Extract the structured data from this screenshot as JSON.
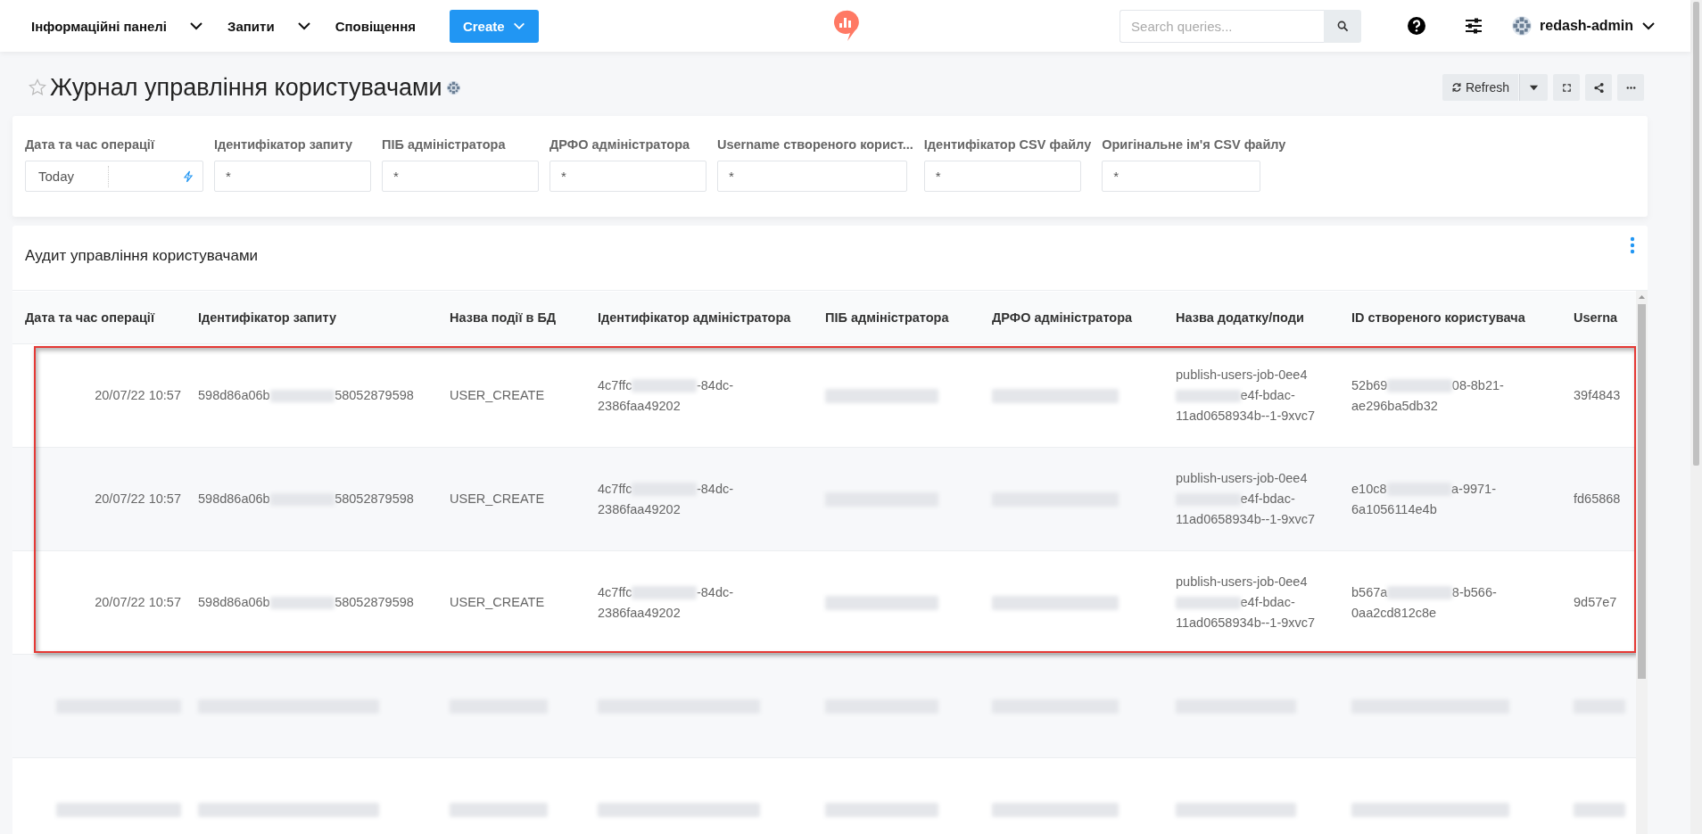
{
  "navbar": {
    "menu": [
      {
        "label": "Інформаційні панелі",
        "dropdown": true
      },
      {
        "label": "Запити",
        "dropdown": true
      },
      {
        "label": "Сповіщення",
        "dropdown": false
      }
    ],
    "create_button": "Create",
    "search": {
      "placeholder": "Search queries..."
    },
    "user": "redash-admin"
  },
  "dashboard": {
    "title": "Журнал управління користувачами",
    "favorite": false,
    "buttons": [
      {
        "kind": "refresh",
        "label": "Refresh"
      },
      {
        "kind": "caret"
      },
      {
        "kind": "fullscreen"
      },
      {
        "kind": "share"
      },
      {
        "kind": "more"
      }
    ]
  },
  "filters": [
    {
      "kind": "date",
      "label": "Дата та час операції",
      "value": "Today"
    },
    {
      "kind": "text",
      "label": "Ідентифікатор запиту",
      "value": "*"
    },
    {
      "kind": "text",
      "label": "ПІБ адміністратора",
      "value": "*"
    },
    {
      "kind": "text",
      "label": "ДРФО адміністратора",
      "value": "*"
    },
    {
      "kind": "text",
      "label": "Username створеного корист...",
      "value": "*"
    },
    {
      "kind": "text",
      "label": "Ідентифікатор CSV файлу",
      "value": "*"
    },
    {
      "kind": "text",
      "label": "Оригінальне ім'я CSV файлу",
      "value": "*"
    }
  ],
  "widget": {
    "title": "Аудит управління користувачами",
    "columns": [
      "Дата та час операції",
      "Ідентифікатор запиту",
      "Назва події в БД",
      "Ідентифікатор адміністратора",
      "ПІБ адміністратора",
      "ДРФО адміністратора",
      "Назва додатку/поди",
      "ID створеного користувача",
      "Userna"
    ],
    "rows": [
      {
        "highlighted": true,
        "cells": [
          [
            {
              "text": "20/07/22 10:57"
            }
          ],
          [
            {
              "text": "598d86a06b"
            },
            {
              "kind": "redacted"
            },
            {
              "text": "58052879598"
            }
          ],
          [
            {
              "text": "USER_CREATE"
            }
          ],
          [
            {
              "text": "4c7ffc"
            },
            {
              "kind": "redacted"
            },
            {
              "text": "-84dc-2386faa49202"
            }
          ],
          [
            {
              "kind": "redacted"
            }
          ],
          [
            {
              "kind": "redacted"
            }
          ],
          [
            {
              "text": "publish-users-job-0ee4"
            },
            {
              "kind": "redacted"
            },
            {
              "text": "e4f-bdac-11ad0658934b--1-9xvc7"
            }
          ],
          [
            {
              "text": "52b69"
            },
            {
              "kind": "redacted"
            },
            {
              "text": "08-8b21-ae296ba5db32"
            }
          ],
          [
            {
              "text": "39f4843"
            }
          ]
        ]
      },
      {
        "highlighted": true,
        "cells": [
          [
            {
              "text": "20/07/22 10:57"
            }
          ],
          [
            {
              "text": "598d86a06b"
            },
            {
              "kind": "redacted"
            },
            {
              "text": "58052879598"
            }
          ],
          [
            {
              "text": "USER_CREATE"
            }
          ],
          [
            {
              "text": "4c7ffc"
            },
            {
              "kind": "redacted"
            },
            {
              "text": "-84dc-2386faa49202"
            }
          ],
          [
            {
              "kind": "redacted"
            }
          ],
          [
            {
              "kind": "redacted"
            }
          ],
          [
            {
              "text": "publish-users-job-0ee4"
            },
            {
              "kind": "redacted"
            },
            {
              "text": "e4f-bdac-11ad0658934b--1-9xvc7"
            }
          ],
          [
            {
              "text": "e10c8"
            },
            {
              "kind": "redacted"
            },
            {
              "text": "a-9971-6a1056114e4b"
            }
          ],
          [
            {
              "text": "fd65868"
            }
          ]
        ]
      },
      {
        "highlighted": true,
        "cells": [
          [
            {
              "text": "20/07/22 10:57"
            }
          ],
          [
            {
              "text": "598d86a06b"
            },
            {
              "kind": "redacted"
            },
            {
              "text": "58052879598"
            }
          ],
          [
            {
              "text": "USER_CREATE"
            }
          ],
          [
            {
              "text": "4c7ffc"
            },
            {
              "kind": "redacted"
            },
            {
              "text": "-84dc-2386faa49202"
            }
          ],
          [
            {
              "kind": "redacted"
            }
          ],
          [
            {
              "kind": "redacted"
            }
          ],
          [
            {
              "text": "publish-users-job-0ee4"
            },
            {
              "kind": "redacted"
            },
            {
              "text": "e4f-bdac-11ad0658934b--1-9xvc7"
            }
          ],
          [
            {
              "text": "b567a"
            },
            {
              "kind": "redacted"
            },
            {
              "text": "8-b566-0aa2cd812c8e"
            }
          ],
          [
            {
              "text": "9d57e7"
            }
          ]
        ]
      },
      {
        "highlighted": false,
        "cells": [
          [
            {
              "kind": "redacted"
            }
          ],
          [
            {
              "kind": "redacted"
            }
          ],
          [
            {
              "kind": "redacted"
            }
          ],
          [
            {
              "kind": "redacted"
            }
          ],
          [
            {
              "kind": "redacted"
            }
          ],
          [
            {
              "kind": "redacted"
            }
          ],
          [
            {
              "kind": "redacted"
            }
          ],
          [
            {
              "kind": "redacted"
            }
          ],
          [
            {
              "kind": "redacted"
            }
          ]
        ]
      },
      {
        "highlighted": false,
        "cells": [
          [
            {
              "kind": "redacted"
            }
          ],
          [
            {
              "kind": "redacted"
            }
          ],
          [
            {
              "kind": "redacted"
            }
          ],
          [
            {
              "kind": "redacted"
            }
          ],
          [
            {
              "kind": "redacted"
            }
          ],
          [
            {
              "kind": "redacted"
            }
          ],
          [
            {
              "kind": "redacted"
            }
          ],
          [
            {
              "kind": "redacted"
            }
          ],
          [
            {
              "kind": "redacted"
            }
          ]
        ]
      }
    ]
  }
}
